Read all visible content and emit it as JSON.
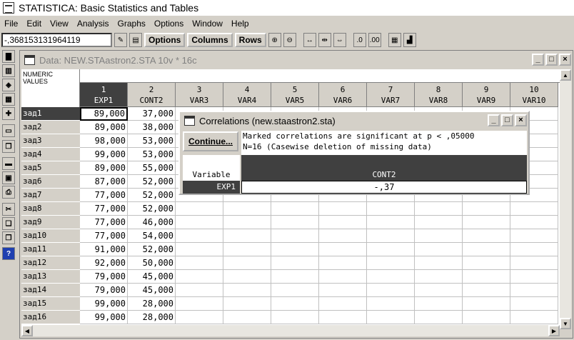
{
  "app": {
    "title": "STATISTICA: Basic Statistics and Tables"
  },
  "menu": [
    "File",
    "Edit",
    "View",
    "Analysis",
    "Graphs",
    "Options",
    "Window",
    "Help"
  ],
  "toolbar": {
    "value": "-,368153131964119",
    "options_label": "Options",
    "columns_label": "Columns",
    "rows_label": "Rows"
  },
  "data_window": {
    "title": "Data: NEW.STAastron2.STA 10v * 16c",
    "corner_label": "NUMERIC VALUES",
    "columns": [
      {
        "num": "1",
        "name": "EXP1"
      },
      {
        "num": "2",
        "name": "CONT2"
      },
      {
        "num": "3",
        "name": "VAR3"
      },
      {
        "num": "4",
        "name": "VAR4"
      },
      {
        "num": "5",
        "name": "VAR5"
      },
      {
        "num": "6",
        "name": "VAR6"
      },
      {
        "num": "7",
        "name": "VAR7"
      },
      {
        "num": "8",
        "name": "VAR8"
      },
      {
        "num": "9",
        "name": "VAR9"
      },
      {
        "num": "10",
        "name": "VAR10"
      }
    ],
    "rows": [
      {
        "label": "зад1",
        "exp1": "89,000",
        "cont2": "37,000"
      },
      {
        "label": "зад2",
        "exp1": "89,000",
        "cont2": "38,000"
      },
      {
        "label": "зад3",
        "exp1": "98,000",
        "cont2": "53,000"
      },
      {
        "label": "зад4",
        "exp1": "99,000",
        "cont2": "53,000"
      },
      {
        "label": "зад5",
        "exp1": "89,000",
        "cont2": "55,000"
      },
      {
        "label": "зад6",
        "exp1": "87,000",
        "cont2": "52,000"
      },
      {
        "label": "зад7",
        "exp1": "77,000",
        "cont2": "52,000"
      },
      {
        "label": "зад8",
        "exp1": "77,000",
        "cont2": "52,000"
      },
      {
        "label": "зад9",
        "exp1": "77,000",
        "cont2": "46,000"
      },
      {
        "label": "зад10",
        "exp1": "77,000",
        "cont2": "54,000"
      },
      {
        "label": "зад11",
        "exp1": "91,000",
        "cont2": "52,000"
      },
      {
        "label": "зад12",
        "exp1": "92,000",
        "cont2": "50,000"
      },
      {
        "label": "зад13",
        "exp1": "79,000",
        "cont2": "45,000"
      },
      {
        "label": "зад14",
        "exp1": "79,000",
        "cont2": "45,000"
      },
      {
        "label": "зад15",
        "exp1": "99,000",
        "cont2": "28,000"
      },
      {
        "label": "зад16",
        "exp1": "99,000",
        "cont2": "28,000"
      }
    ]
  },
  "dialog": {
    "title": "Correlations (new.staastron2.sta)",
    "continue_label": "Continue...",
    "note_line1": "Marked correlations are significant at p < ,05000",
    "note_line2": "N=16 (Casewise deletion of missing data)",
    "variable_header": "Variable",
    "column_header": "CONT2",
    "row_label": "EXP1",
    "value": "-,37"
  },
  "window_buttons": {
    "minimize": "_",
    "maximize": "□",
    "close": "×"
  }
}
